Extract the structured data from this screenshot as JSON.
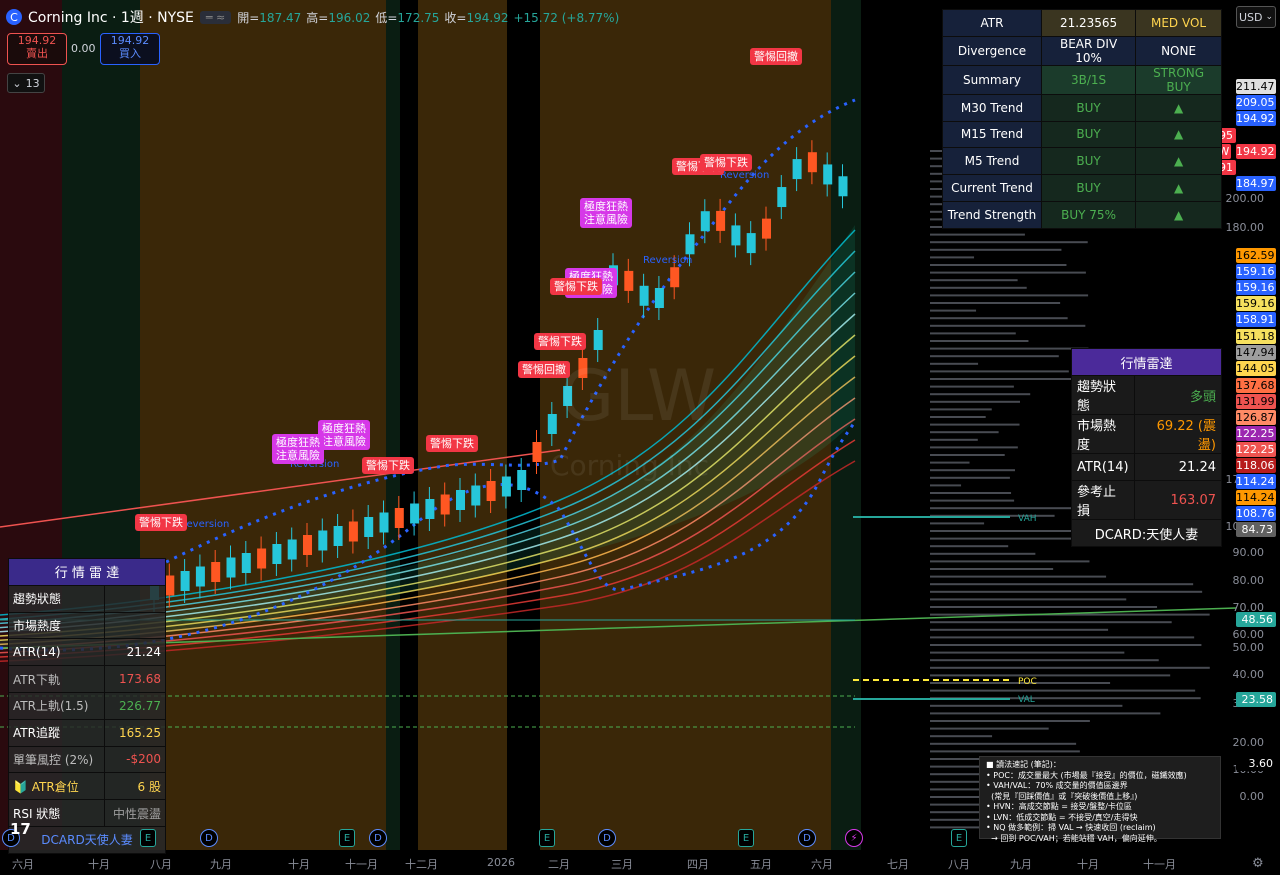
{
  "header": {
    "logo_letter": "C",
    "symbol": "Corning Inc · 1週 · NYSE",
    "pill": "═ ≈",
    "ohlc": [
      {
        "k": "開=",
        "v": "187.47"
      },
      {
        "k": "高=",
        "v": "196.02"
      },
      {
        "k": "低=",
        "v": "172.75"
      },
      {
        "k": "收=",
        "v": "194.92"
      },
      {
        "k": "",
        "v": "+15.72 (+8.77%)"
      }
    ]
  },
  "trade": {
    "sell_price": "194.92",
    "sell_label": "賣出",
    "spread": "0.00",
    "buy_price": "194.92",
    "buy_label": "買入"
  },
  "interval_selector": "13",
  "currency": "USD",
  "price_axis": [
    "200.00",
    "180.00",
    "170.00",
    "100.00",
    "90.00",
    "80.00",
    "70.00",
    "60.00",
    "50.00",
    "40.00",
    "30.00",
    "20.00",
    "10.00",
    "0.00"
  ],
  "price_tags": [
    {
      "v": "211.47",
      "bg": "#e0e0e0",
      "fg": "#000"
    },
    {
      "v": "209.05",
      "bg": "#2962ff",
      "fg": "#fff"
    },
    {
      "v": "194.92",
      "bg": "#2962ff",
      "fg": "#fff"
    },
    {
      "v": "195",
      "bg": "#f23645",
      "fg": "#fff"
    },
    {
      "v": "194.92",
      "bg": "#f23645",
      "fg": "#fff"
    },
    {
      "v": "191",
      "bg": "#f23645",
      "fg": "#fff"
    },
    {
      "v": "184.97",
      "bg": "#2962ff",
      "fg": "#fff"
    },
    {
      "v": "162.59",
      "bg": "#ff9800",
      "fg": "#000"
    },
    {
      "v": "159.16",
      "bg": "#2962ff",
      "fg": "#fff"
    },
    {
      "v": "159.16",
      "bg": "#2962ff",
      "fg": "#fff"
    },
    {
      "v": "159.16",
      "bg": "#f6e05e",
      "fg": "#000"
    },
    {
      "v": "158.91",
      "bg": "#2962ff",
      "fg": "#fff"
    },
    {
      "v": "151.18",
      "bg": "#f6e05e",
      "fg": "#000"
    },
    {
      "v": "147.94",
      "bg": "#9e9e9e",
      "fg": "#000"
    },
    {
      "v": "144.05",
      "bg": "#ffd54f",
      "fg": "#000"
    },
    {
      "v": "137.68",
      "bg": "#ff7043",
      "fg": "#000"
    },
    {
      "v": "131.99",
      "bg": "#ef5350",
      "fg": "#000"
    },
    {
      "v": "126.87",
      "bg": "#ff8a65",
      "fg": "#000"
    },
    {
      "v": "122.25",
      "bg": "#9c27b0",
      "fg": "#fff"
    },
    {
      "v": "122.25",
      "bg": "#ef5350",
      "fg": "#fff"
    },
    {
      "v": "118.06",
      "bg": "#b71c1c",
      "fg": "#fff"
    },
    {
      "v": "114.24",
      "bg": "#2962ff",
      "fg": "#fff"
    },
    {
      "v": "114.24",
      "bg": "#ff9800",
      "fg": "#000"
    },
    {
      "v": "108.76",
      "bg": "#2962ff",
      "fg": "#fff"
    },
    {
      "v": "84.73",
      "bg": "#616161",
      "fg": "#fff"
    },
    {
      "v": "48.56",
      "bg": "#26a69a",
      "fg": "#fff"
    },
    {
      "v": "23.58",
      "bg": "#26a69a",
      "fg": "#fff"
    },
    {
      "v": "3.60",
      "bg": "#000",
      "fg": "#fff"
    }
  ],
  "glw_tag": "GLW",
  "top_table": [
    {
      "c1": "ATR",
      "c2": "21.23565",
      "c3": "MED VOL"
    },
    {
      "c1": "Divergence",
      "c2": "BEAR DIV 10%",
      "c3": "NONE"
    },
    {
      "c1": "Summary",
      "c2": "3B/1S",
      "c3": "STRONG BUY"
    },
    {
      "c1": "M30 Trend",
      "c2": "BUY",
      "c3": "▲"
    },
    {
      "c1": "M15 Trend",
      "c2": "BUY",
      "c3": "▲"
    },
    {
      "c1": "M5 Trend",
      "c2": "BUY",
      "c3": "▲"
    },
    {
      "c1": "Current Trend",
      "c2": "BUY",
      "c3": "▲"
    },
    {
      "c1": "Trend Strength",
      "c2": "BUY 75%",
      "c3": "▲"
    }
  ],
  "radar_right": {
    "title": "行情雷達",
    "rows": [
      {
        "k": "趨勢狀態",
        "v": "多頭"
      },
      {
        "k": "市場熱度",
        "v": "69.22 (震盪)"
      },
      {
        "k": "ATR(14)",
        "v": "21.24"
      },
      {
        "k": "參考止損",
        "v": "163.07"
      }
    ],
    "footer": "DCARD:天使人妻"
  },
  "radar_left": {
    "title": "行 情 雷 達",
    "rows": [
      {
        "k": "趨勢狀態",
        "v": ""
      },
      {
        "k": "市場熱度",
        "v": ""
      },
      {
        "k": "ATR(14)",
        "v": "21.24"
      },
      {
        "k": "ATR下軌",
        "v": "173.68"
      },
      {
        "k": "ATR上軌(1.5)",
        "v": "226.77"
      },
      {
        "k": "ATR追蹤",
        "v": "165.25"
      },
      {
        "k": "單筆風控 (2%)",
        "v": "-$200"
      },
      {
        "k": "🔰 ATR倉位",
        "v": "6 股"
      },
      {
        "k": "RSI 狀態",
        "v": "中性震盪"
      }
    ],
    "footer": "DCARD天使人妻"
  },
  "notes": [
    "■ 讀法速記 (筆記)：",
    "• POC：成交量最大 (市場最『接受』的價位，磁鐵效應)",
    "• VAH/VAL：70% 成交量的價值區邊界",
    "  (常見『回踩價值』或『突破後價值上移』)",
    "• HVN：高成交節點 = 接受/盤整/卡位區",
    "• LVN：低成交節點 = 不接受/真空/走得快",
    "• NQ 做多範例：掃 VAL → 快速收回 (reclaim)",
    "  → 回到 POC/VAH；若能站穩 VAH，偏向延伸。"
  ],
  "vp_labels": {
    "vah": "VAH",
    "poc": "POC",
    "val": "VAL"
  },
  "watermark": {
    "big": "GLW",
    "small": "Corning Inc"
  },
  "signals": [
    {
      "t": "警惕回撤",
      "c": "red"
    },
    {
      "t": "警惕下跌",
      "c": "red"
    },
    {
      "t": "警惕下跌",
      "c": "red"
    },
    {
      "t": "極度狂熱\n注意風險",
      "c": "pink"
    },
    {
      "t": "極度狂熱\n注意風險",
      "c": "pink"
    },
    {
      "t": "警惕下跌",
      "c": "red"
    },
    {
      "t": "警惕下跌",
      "c": "red"
    },
    {
      "t": "警惕回撤",
      "c": "red"
    },
    {
      "t": "警惕下跌",
      "c": "red"
    },
    {
      "t": "極度狂熱\n注意風險",
      "c": "pink"
    },
    {
      "t": "極度狂熱\n注意風險",
      "c": "pink"
    },
    {
      "t": "警惕下跌",
      "c": "red"
    },
    {
      "t": "警惕下跌",
      "c": "red"
    }
  ],
  "reversion_label": "Reversion",
  "x_axis": [
    "六月",
    "十月",
    "八月",
    "九月",
    "十月",
    "十一月",
    "十二月",
    "2026",
    "二月",
    "三月",
    "四月",
    "五月",
    "六月",
    "七月",
    "八月",
    "九月",
    "十月",
    "十一月"
  ],
  "colors": {
    "up": "#26c6da",
    "down": "#ff5722",
    "accent": "#2962ff"
  }
}
